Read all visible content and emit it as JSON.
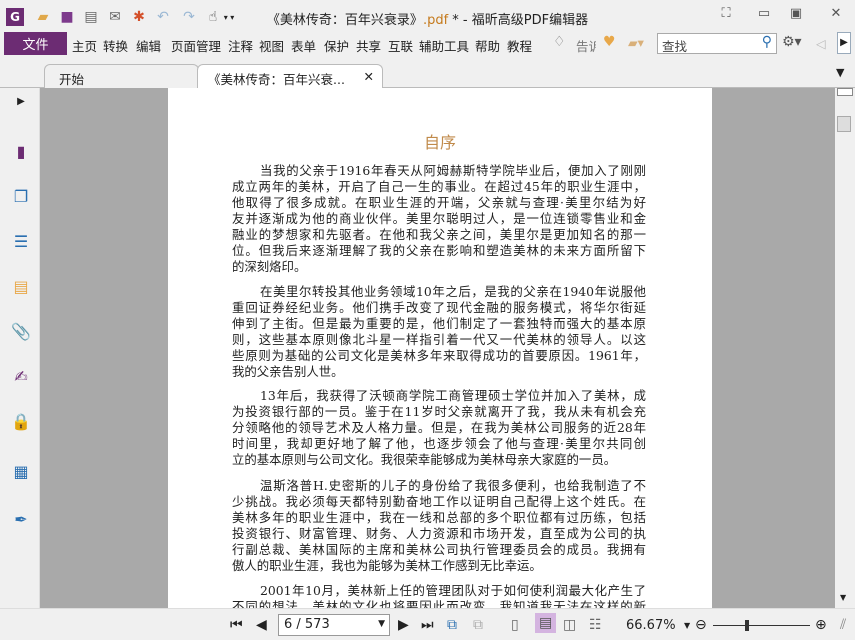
{
  "titlebar": {
    "title_name": "《美林传奇：百年兴衰录》",
    "title_ext": ".pdf",
    "title_suffix": " * - 福昕高级PDF编辑器"
  },
  "menubar": {
    "file": "文件",
    "items": [
      "主页",
      "转换",
      "编辑",
      "页面管理",
      "注释",
      "视图",
      "表单",
      "保护",
      "共享",
      "互联",
      "辅助工具",
      "帮助",
      "教程"
    ],
    "tell_me": "告诉",
    "search_placeholder": "查找"
  },
  "tabs": [
    {
      "label": "开始"
    },
    {
      "label": "《美林传奇：百年兴衰..."
    }
  ],
  "document": {
    "title": "自序",
    "paragraphs": [
      [
        "当我的父亲于1916年春天从阿姆赫斯特学院毕业后，便加入了刚刚",
        "成立两年的美林，开启了自己一生的事业。在超过45年的职业生涯中，",
        "他取得了很多成就。在职业生涯的开端，父亲就与查理·美里尔结为好",
        "友并逐渐成为他的商业伙伴。美里尔聪明过人，是一位连锁零售业和金",
        "融业的梦想家和先驱者。在他和我父亲之间，美里尔是更加知名的那一",
        "位。但我后来逐渐理解了我的父亲在影响和塑造美林的未来方面所留下",
        "的深刻烙印。"
      ],
      [
        "在美里尔转投其他业务领域10年之后，是我的父亲在1940年说服他",
        "重回证券经纪业务。他们携手改变了现代金融的服务模式，将华尔街延",
        "伸到了主街。但是最为重要的是，他们制定了一套独特而强大的基本原",
        "则，这些基本原则像北斗星一样指引着一代又一代美林的领导人。以这",
        "些原则为基础的公司文化是美林多年来取得成功的首要原因。1961年，",
        "我的父亲告别人世。"
      ],
      [
        "13年后，我获得了沃顿商学院工商管理硕士学位并加入了美林，成",
        "为投资银行部的一员。鉴于在11岁时父亲就离开了我，我从未有机会充",
        "分领略他的领导艺术及人格力量。但是，在我为美林公司服务的近28年",
        "时间里，我却更好地了解了他，也逐步领会了他与查理·美里尔共同创",
        "立的基本原则与公司文化。我很荣幸能够成为美林母亲大家庭的一员。"
      ],
      [
        "温斯洛普H.史密斯的儿子的身份给了我很多便利，也给我制造了不",
        "少挑战。我必须每天都特别勤奋地工作以证明自己配得上这个姓氏。在",
        "美林多年的职业生涯中，我在一线和总部的多个职位都有过历练，包括",
        "投资银行、财富管理、财务、人力资源和市场开发，直至成为公司的执",
        "行副总裁、美林国际的主席和美林公司执行管理委员会的成员。我拥有",
        "傲人的职业生涯，我也为能够为美林工作感到无比幸运。"
      ],
      [
        "2001年10月，美林新上任的管理团队对于如何使利润最大化产生了",
        "不同的想法，美林的文化也将要因此而改变。我知道我无法在这样的新"
      ]
    ]
  },
  "status": {
    "page_indicator": "6 / 573",
    "zoom": "66.67%",
    "zoom_slider_fraction": 0.35
  }
}
